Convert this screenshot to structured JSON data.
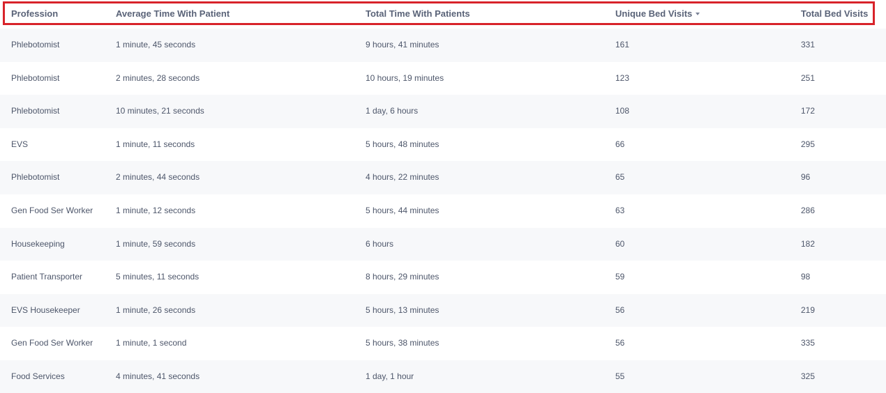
{
  "table": {
    "columns": [
      {
        "label": "Profession"
      },
      {
        "label": "Average Time With Patient"
      },
      {
        "label": "Total Time With Patients"
      },
      {
        "label": "Unique Bed Visits",
        "sorted": "descending",
        "sort_icon": "caret-down-icon"
      },
      {
        "label": "Total Bed Visits"
      }
    ],
    "rows": [
      [
        "Phlebotomist",
        "1 minute, 45 seconds",
        "9 hours, 41 minutes",
        "161",
        "331"
      ],
      [
        "Phlebotomist",
        "2 minutes, 28 seconds",
        "10 hours, 19 minutes",
        "123",
        "251"
      ],
      [
        "Phlebotomist",
        "10 minutes, 21 seconds",
        "1 day, 6 hours",
        "108",
        "172"
      ],
      [
        "EVS",
        "1 minute, 11 seconds",
        "5 hours, 48 minutes",
        "66",
        "295"
      ],
      [
        "Phlebotomist",
        "2 minutes, 44 seconds",
        "4 hours, 22 minutes",
        "65",
        "96"
      ],
      [
        "Gen Food Ser Worker",
        "1 minute, 12 seconds",
        "5 hours, 44 minutes",
        "63",
        "286"
      ],
      [
        "Housekeeping",
        "1 minute, 59 seconds",
        "6 hours",
        "60",
        "182"
      ],
      [
        "Patient Transporter",
        "5 minutes, 11 seconds",
        "8 hours, 29 minutes",
        "59",
        "98"
      ],
      [
        "EVS Housekeeper",
        "1 minute, 26 seconds",
        "5 hours, 13 minutes",
        "56",
        "219"
      ],
      [
        "Gen Food Ser Worker",
        "1 minute, 1 second",
        "5 hours, 38 minutes",
        "56",
        "335"
      ],
      [
        "Food Services",
        "4 minutes, 41 seconds",
        "1 day, 1 hour",
        "55",
        "325"
      ]
    ]
  },
  "colors": {
    "highlight_border": "#d8232a",
    "header_text": "#5a6378",
    "cell_text": "#4d566a",
    "row_alt": "#f7f8fa"
  }
}
